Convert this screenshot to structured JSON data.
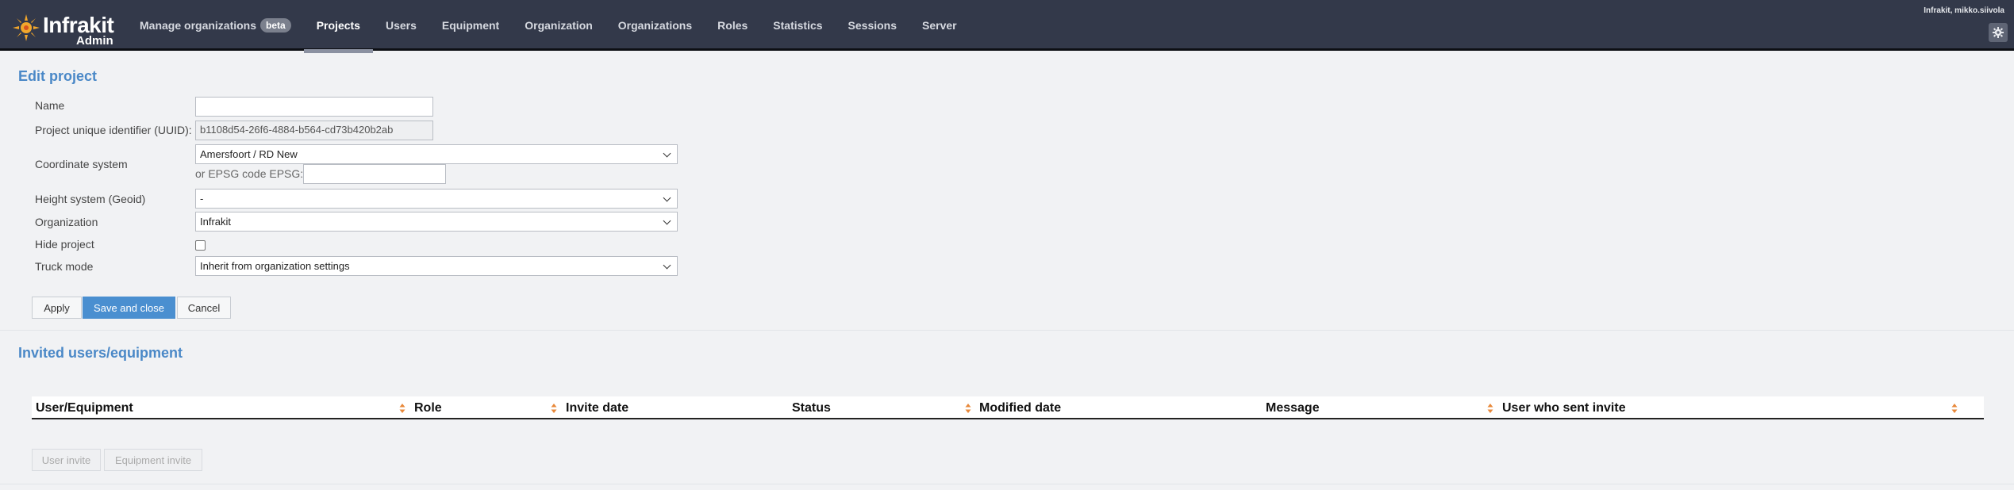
{
  "app": {
    "logo_text": "Infrakit",
    "logo_sub": "Admin",
    "user": "Infrakit, mikko.siivola"
  },
  "nav": {
    "items": [
      {
        "label": "Manage organizations",
        "badge": "beta"
      },
      {
        "label": "Projects"
      },
      {
        "label": "Users"
      },
      {
        "label": "Equipment"
      },
      {
        "label": "Organization"
      },
      {
        "label": "Organizations"
      },
      {
        "label": "Roles"
      },
      {
        "label": "Statistics"
      },
      {
        "label": "Sessions"
      },
      {
        "label": "Server"
      }
    ],
    "active": "Projects"
  },
  "edit_project": {
    "title": "Edit project",
    "name_label": "Name",
    "name_value": "",
    "uuid_label": "Project unique identifier (UUID):",
    "uuid_value": "b1108d54-26f6-4884-b564-cd73b420b2ab",
    "coord_label": "Coordinate system",
    "coord_value": "Amersfoort / RD New",
    "epsg_label": "or EPSG code EPSG:",
    "epsg_value": "",
    "height_label": "Height system (Geoid)",
    "height_value": "-",
    "org_label": "Organization",
    "org_value": "Infrakit",
    "hide_label": "Hide project",
    "hide_checked": false,
    "truck_label": "Truck mode",
    "truck_value": "Inherit from organization settings",
    "apply": "Apply",
    "save_close": "Save and close",
    "cancel": "Cancel"
  },
  "invited": {
    "title": "Invited users/equipment",
    "columns": [
      "User/Equipment",
      "Role",
      "Invite date",
      "Status",
      "Modified date",
      "Message",
      "User who sent invite"
    ],
    "user_invite": "User invite",
    "equipment_invite": "Equipment invite"
  },
  "colors": {
    "navbar": "#33394a",
    "accent": "#4a88c7",
    "sort_arrow": "#e8883a"
  }
}
